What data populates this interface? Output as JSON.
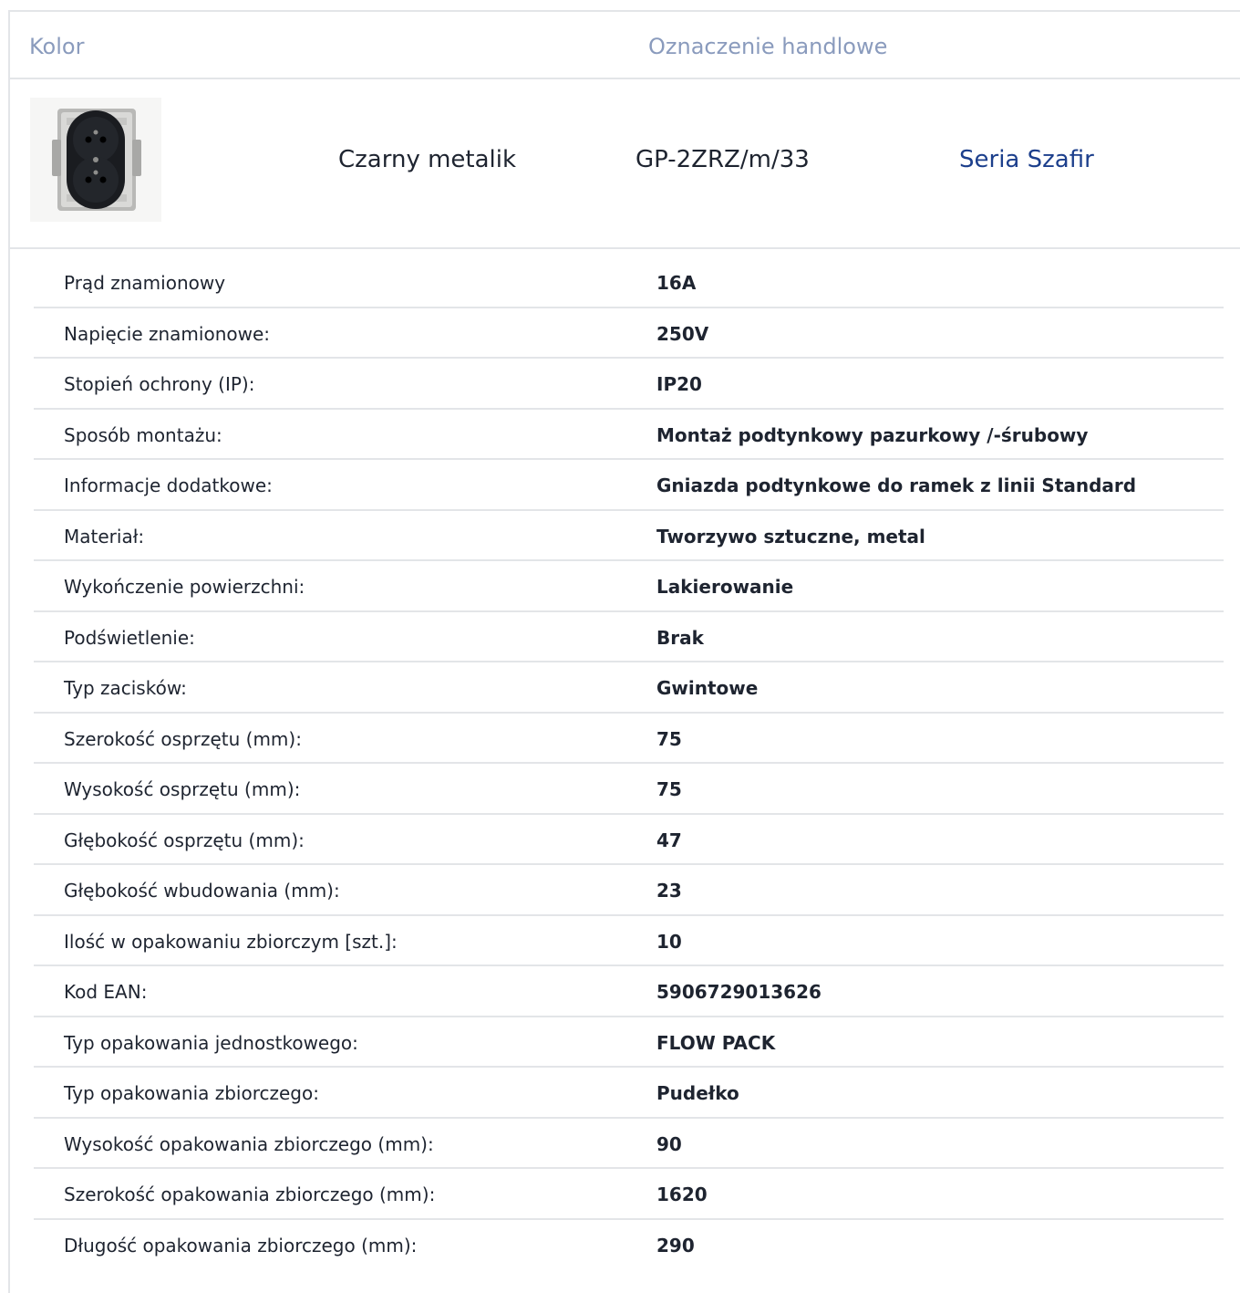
{
  "header": {
    "color_label": "Kolor",
    "trade_name_label": "Oznaczenie handlowe"
  },
  "product": {
    "image_icon": "socket-image",
    "color": "Czarny metalik",
    "code": "GP-2ZRZ/m/33",
    "series_link": "Seria Szafir"
  },
  "specs": [
    {
      "label": "Prąd znamionowy",
      "value": "16A"
    },
    {
      "label": "Napięcie znamionowe:",
      "value": "250V"
    },
    {
      "label": "Stopień ochrony (IP):",
      "value": "IP20"
    },
    {
      "label": "Sposób montażu:",
      "value": "Montaż podtynkowy pazurkowy /-śrubowy"
    },
    {
      "label": "Informacje dodatkowe:",
      "value": "Gniazda podtynkowe do ramek z linii Standard"
    },
    {
      "label": "Materiał:",
      "value": "Tworzywo sztuczne, metal"
    },
    {
      "label": "Wykończenie powierzchni:",
      "value": "Lakierowanie"
    },
    {
      "label": "Podświetlenie:",
      "value": "Brak"
    },
    {
      "label": "Typ zacisków:",
      "value": "Gwintowe"
    },
    {
      "label": "Szerokość osprzętu (mm):",
      "value": "75"
    },
    {
      "label": "Wysokość osprzętu (mm):",
      "value": "75"
    },
    {
      "label": "Głębokość osprzętu (mm):",
      "value": "47"
    },
    {
      "label": "Głębokość wbudowania (mm):",
      "value": "23"
    },
    {
      "label": "Ilość w opakowaniu zbiorczym [szt.]:",
      "value": "10"
    },
    {
      "label": "Kod EAN:",
      "value": "5906729013626"
    },
    {
      "label": "Typ opakowania jednostkowego:",
      "value": "FLOW PACK"
    },
    {
      "label": "Typ opakowania zbiorczego:",
      "value": "Pudełko"
    },
    {
      "label": "Wysokość opakowania zbiorczego (mm):",
      "value": "90"
    },
    {
      "label": "Szerokość opakowania zbiorczego (mm):",
      "value": "1620"
    },
    {
      "label": "Długość opakowania zbiorczego (mm):",
      "value": "290"
    }
  ]
}
